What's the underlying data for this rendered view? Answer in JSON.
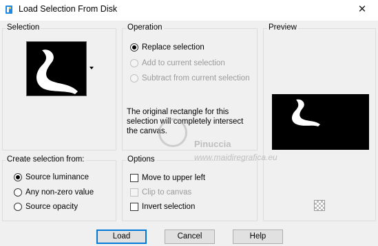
{
  "window": {
    "title": "Load Selection From Disk",
    "close_glyph": "✕",
    "app_icon": "paintshop-icon"
  },
  "selection_group": {
    "title": "Selection"
  },
  "operation_group": {
    "title": "Operation",
    "options": [
      {
        "label": "Replace selection",
        "checked": true,
        "enabled": true
      },
      {
        "label": "Add to current selection",
        "checked": false,
        "enabled": false
      },
      {
        "label": "Subtract from current selection",
        "checked": false,
        "enabled": false
      }
    ],
    "description": "The original rectangle for this selection will completely intersect the canvas."
  },
  "preview_group": {
    "title": "Preview"
  },
  "create_from_group": {
    "title": "Create selection from:",
    "options": [
      {
        "label": "Source luminance",
        "checked": true
      },
      {
        "label": "Any non-zero value",
        "checked": false
      },
      {
        "label": "Source opacity",
        "checked": false
      }
    ]
  },
  "options_group": {
    "title": "Options",
    "items": [
      {
        "label": "Move to upper left",
        "checked": false,
        "enabled": true
      },
      {
        "label": "Clip to canvas",
        "checked": false,
        "enabled": false
      },
      {
        "label": "Invert selection",
        "checked": false,
        "enabled": true
      }
    ]
  },
  "watermark": {
    "name": "Pinuccia",
    "site": "www.maidiregrafica.eu"
  },
  "buttons": {
    "load": "Load",
    "cancel": "Cancel",
    "help": "Help"
  }
}
